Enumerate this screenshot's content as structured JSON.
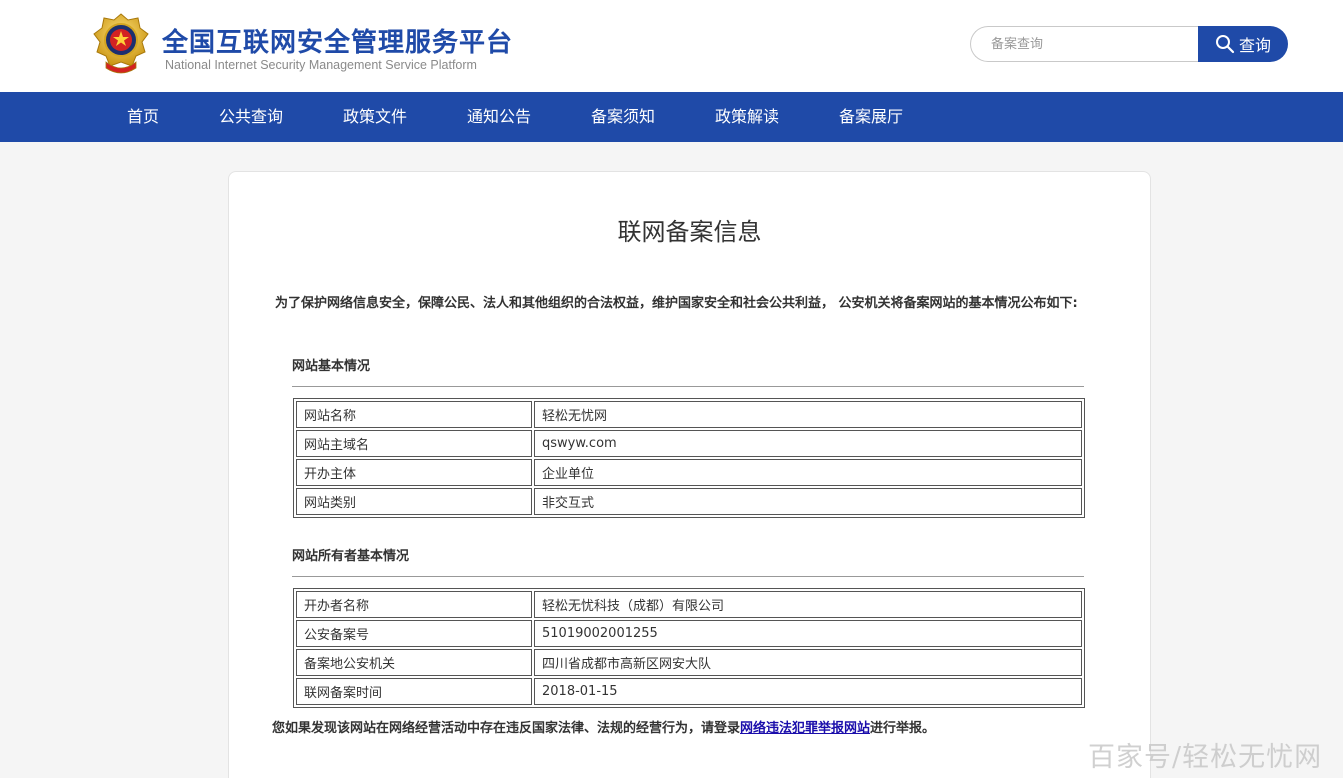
{
  "header": {
    "title": "全国互联网安全管理服务平台",
    "subtitle": "National Internet Security Management Service Platform",
    "emblem_icon": "police-emblem-icon",
    "search": {
      "placeholder": "备案查询",
      "value": "",
      "button_label": "查询",
      "icon": "search-icon"
    }
  },
  "nav": {
    "items": [
      {
        "label": "首页"
      },
      {
        "label": "公共查询"
      },
      {
        "label": "政策文件"
      },
      {
        "label": "通知公告"
      },
      {
        "label": "备案须知"
      },
      {
        "label": "政策解读"
      },
      {
        "label": "备案展厅"
      }
    ]
  },
  "main": {
    "title": "联网备案信息",
    "intro": "为了保护网络信息安全，保障公民、法人和其他组织的合法权益，维护国家安全和社会公共利益， 公安机关将备案网站的基本情况公布如下:",
    "site_section": {
      "title": "网站基本情况",
      "rows": [
        {
          "key": "网站名称",
          "value": "轻松无忧网"
        },
        {
          "key": "网站主域名",
          "value": "qswyw.com"
        },
        {
          "key": "开办主体",
          "value": "企业单位"
        },
        {
          "key": "网站类别",
          "value": "非交互式"
        }
      ]
    },
    "owner_section": {
      "title": "网站所有者基本情况",
      "rows": [
        {
          "key": "开办者名称",
          "value": "轻松无忧科技（成都）有限公司"
        },
        {
          "key": "公安备案号",
          "value": "51019002001255"
        },
        {
          "key": "备案地公安机关",
          "value": "四川省成都市高新区网安大队"
        },
        {
          "key": "联网备案时间",
          "value": "2018-01-15"
        }
      ]
    },
    "report": {
      "prefix": "您如果发现该网站在网络经营活动中存在违反国家法律、法规的经营行为，请登录",
      "link": "网络违法犯罪举报网站",
      "suffix": "进行举报。"
    }
  },
  "watermark": "百家号/轻松无忧网",
  "colors": {
    "brand_blue": "#1f4aa8",
    "link": "#1a0dab",
    "page_bg": "#f5f5f5"
  }
}
